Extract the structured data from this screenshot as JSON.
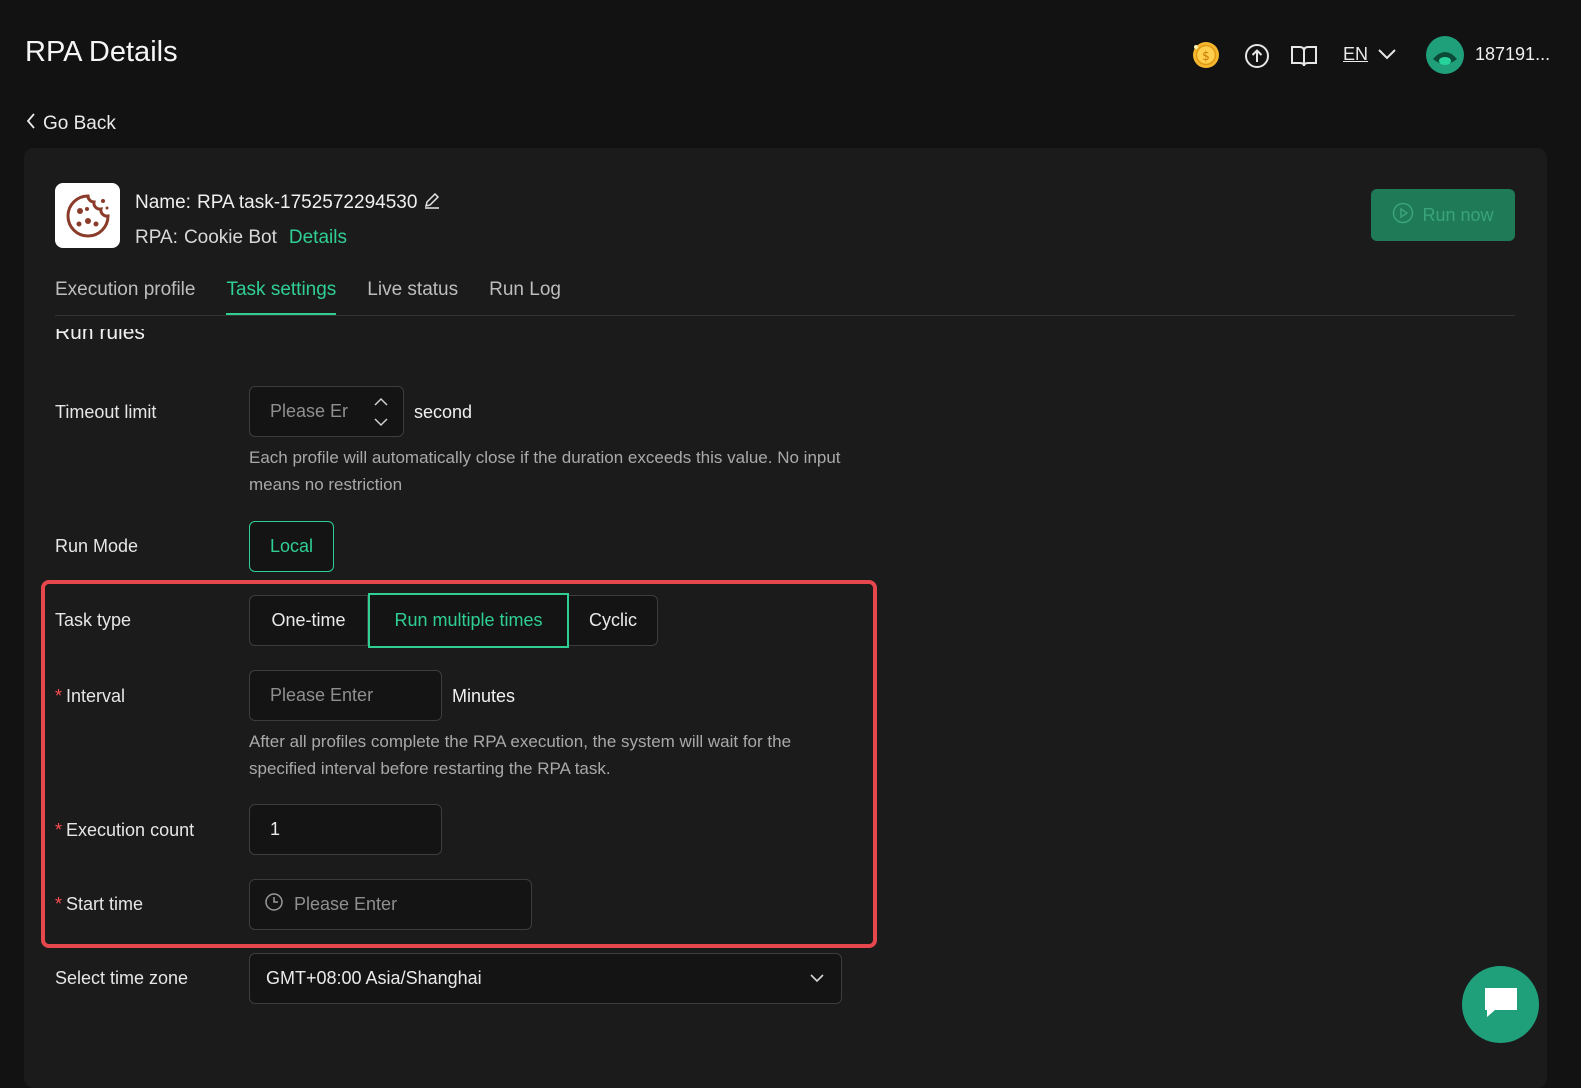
{
  "header": {
    "title": "RPA Details",
    "language": "EN",
    "username": "187191..."
  },
  "nav": {
    "go_back": "Go Back"
  },
  "task": {
    "name_label": "Name:",
    "name_value": "RPA task-1752572294530",
    "rpa_label": "RPA:",
    "rpa_value": "Cookie Bot",
    "details_link": "Details",
    "run_now": "Run now"
  },
  "tabs": [
    {
      "label": "Execution profile",
      "active": false
    },
    {
      "label": "Task settings",
      "active": true
    },
    {
      "label": "Live status",
      "active": false
    },
    {
      "label": "Run Log",
      "active": false
    }
  ],
  "section": {
    "title": "Run rules"
  },
  "form": {
    "timeout": {
      "label": "Timeout limit",
      "placeholder": "Please Er",
      "unit": "second",
      "hint": "Each profile will automatically close if the duration exceeds this value. No input means no restriction"
    },
    "run_mode": {
      "label": "Run Mode",
      "value": "Local"
    },
    "task_type": {
      "label": "Task type",
      "options": [
        "One-time",
        "Run multiple times",
        "Cyclic"
      ],
      "selected": "Run multiple times"
    },
    "interval": {
      "label": "Interval",
      "placeholder": "Please Enter",
      "unit": "Minutes",
      "hint": "After all profiles complete the RPA execution, the system will wait for the specified interval before restarting the RPA task."
    },
    "execution_count": {
      "label": "Execution count",
      "value": "1"
    },
    "start_time": {
      "label": "Start time",
      "placeholder": "Please Enter"
    },
    "time_zone": {
      "label": "Select time zone",
      "value": "GMT+08:00 Asia/Shanghai"
    }
  },
  "colors": {
    "accent": "#2fcf94",
    "highlight_border": "#e5474d",
    "required": "#ff4d4f"
  },
  "icons": [
    "coin-icon",
    "upload-icon",
    "book-icon",
    "chevron-down-icon",
    "avatar",
    "chevron-left-icon",
    "cookie-icon",
    "edit-icon",
    "play-icon",
    "clock-icon",
    "chat-icon"
  ]
}
